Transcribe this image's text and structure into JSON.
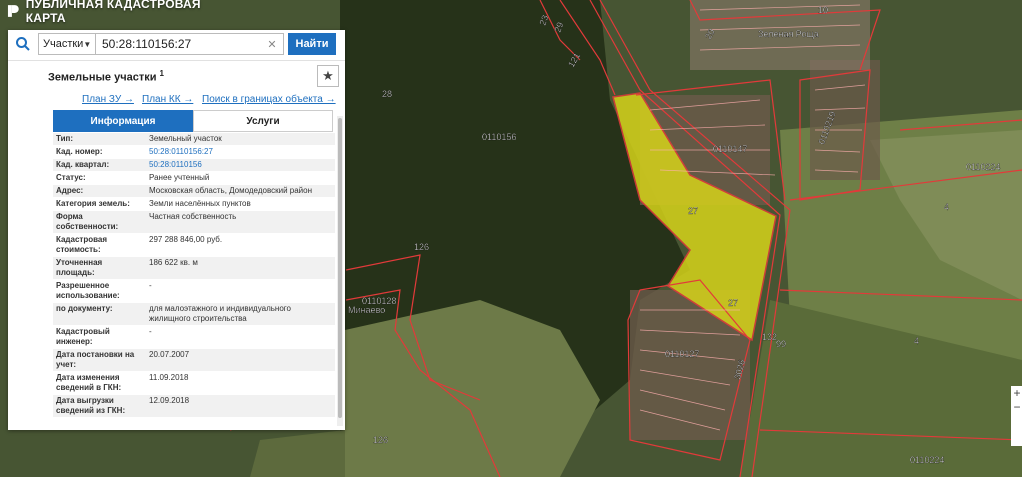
{
  "app": {
    "title": "ПУБЛИЧНАЯ КАДАСТРОВАЯ КАРТА"
  },
  "search": {
    "dropdown_value": "Участки",
    "value": "50:28:110156:27",
    "button": "Найти"
  },
  "panel": {
    "title": "Земельные участки",
    "count": "1",
    "links": [
      "План ЗУ →",
      "План КК →",
      "Поиск в границах объекта →"
    ],
    "tabs": [
      "Информация",
      "Услуги"
    ],
    "rows": [
      {
        "k": "Тип:",
        "v": "Земельный участок"
      },
      {
        "k": "Кад. номер:",
        "v": "50:28:0110156:27"
      },
      {
        "k": "Кад. квартал:",
        "v": "50:28:0110156"
      },
      {
        "k": "Статус:",
        "v": "Ранее учтенный"
      },
      {
        "k": "Адрес:",
        "v": "Московская область, Домодедовский район"
      },
      {
        "k": "Категория земель:",
        "v": "Земли населённых пунктов"
      },
      {
        "k": "Форма собственности:",
        "v": "Частная собственность"
      },
      {
        "k": "Кадастровая стоимость:",
        "v": "297 288 846,00 руб."
      },
      {
        "k": "Уточненная площадь:",
        "v": "186 622 кв. м"
      },
      {
        "k": "Разрешенное использование:",
        "v": "-"
      },
      {
        "k": "по документу:",
        "v": "для малоэтажного и индивидуального жилищного строительства"
      },
      {
        "k": "Кадастровый инженер:",
        "v": "-"
      },
      {
        "k": "Дата постановки на учет:",
        "v": "20.07.2007"
      },
      {
        "k": "Дата изменения сведений в ГКН:",
        "v": "11.09.2018"
      },
      {
        "k": "Дата выгрузки сведений из ГКН:",
        "v": "12.09.2018"
      }
    ]
  },
  "map_labels": [
    "0110156",
    "0110147",
    "0110219",
    "0110224",
    "0110127",
    "0110128",
    "0110224",
    "Зеленая Роща",
    "Минаево",
    "27",
    "27",
    "28",
    "126",
    "126",
    "132",
    "99",
    "4",
    "4",
    "10",
    "121",
    "23",
    "29",
    "20",
    "1",
    "26",
    "3026"
  ],
  "zoom": {
    "plus": "+",
    "minus": "−"
  },
  "colors": {
    "accent": "#1e6fbf",
    "parcel": "#e8e800",
    "boundary": "#e23a3a"
  }
}
